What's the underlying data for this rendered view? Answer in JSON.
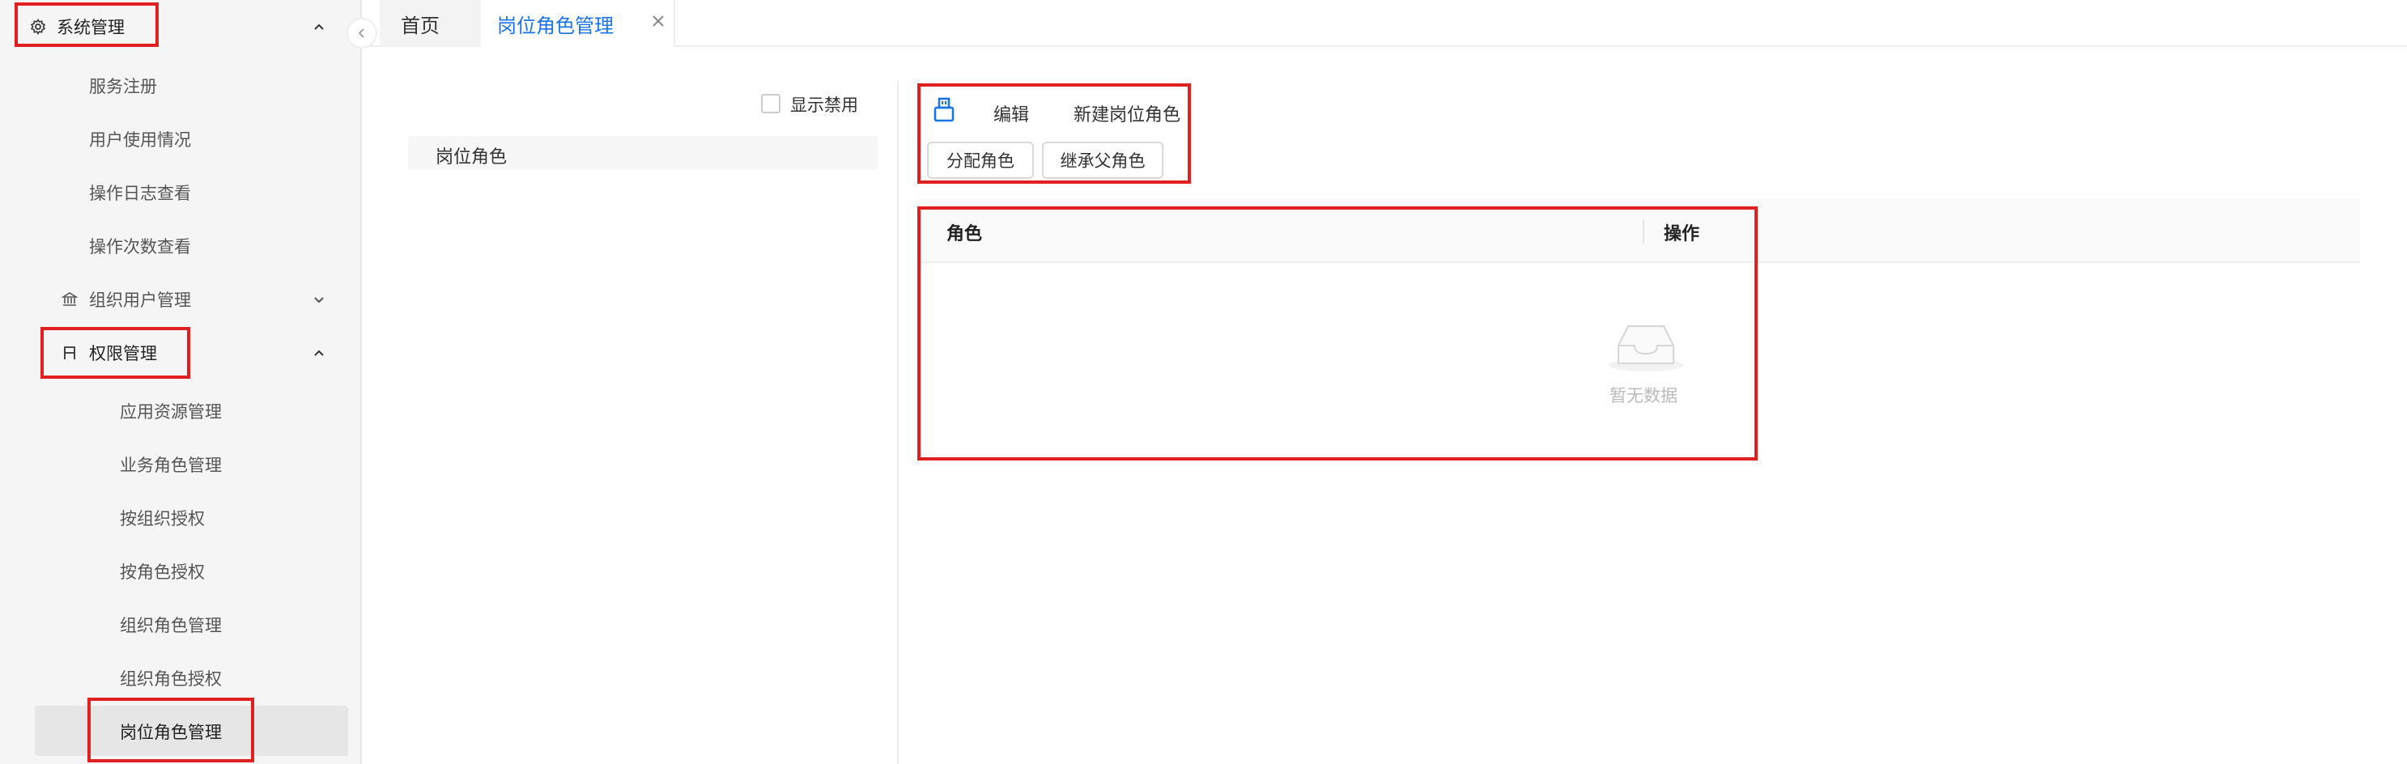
{
  "sidebar": {
    "items": [
      {
        "label": "系统管理",
        "icon": "gear-icon",
        "chevron": "chevron-up-icon"
      },
      {
        "label": "服务注册"
      },
      {
        "label": "用户使用情况"
      },
      {
        "label": "操作日志查看"
      },
      {
        "label": "操作次数查看"
      },
      {
        "label": "组织用户管理",
        "icon": "bank-icon",
        "chevron": "chevron-down-icon"
      },
      {
        "label": "权限管理",
        "icon": "permission-icon",
        "chevron": "chevron-up-icon"
      },
      {
        "label": "应用资源管理"
      },
      {
        "label": "业务角色管理"
      },
      {
        "label": "按组织授权"
      },
      {
        "label": "按角色授权"
      },
      {
        "label": "组织角色管理"
      },
      {
        "label": "组织角色授权"
      },
      {
        "label": "岗位角色管理"
      }
    ]
  },
  "tabs": [
    {
      "label": "首页"
    },
    {
      "label": "岗位角色管理",
      "active": true
    }
  ],
  "tree": {
    "show_disabled_label": "显示禁用",
    "root_label": "岗位角色"
  },
  "toolbar": {
    "edit_label": "编辑",
    "new_label": "新建岗位角色",
    "assign_label": "分配角色",
    "inherit_label": "继承父角色"
  },
  "table": {
    "columns": [
      "角色",
      "操作"
    ],
    "empty_text": "暂无数据"
  },
  "colors": {
    "accent": "#1a73e8",
    "highlight": "#e02020"
  }
}
